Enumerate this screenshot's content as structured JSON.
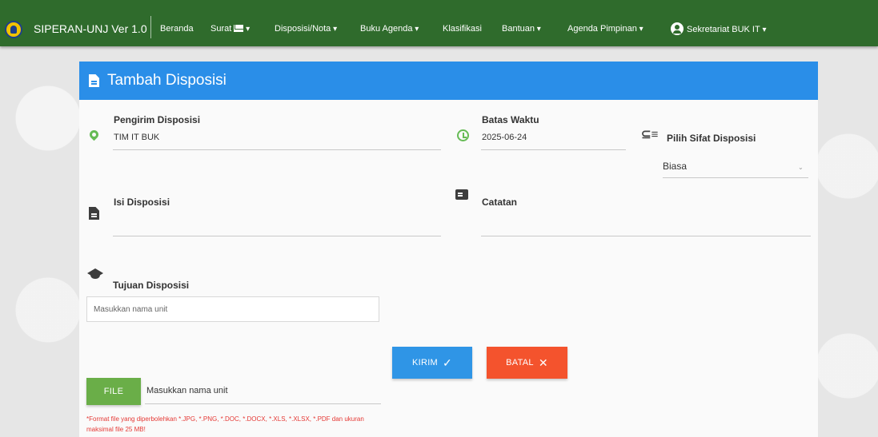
{
  "navbar": {
    "brand": "SIPERAN-UNJ Ver 1.0",
    "items": [
      {
        "label": "Beranda",
        "dropdown": false
      },
      {
        "label": "Surat",
        "dropdown": true,
        "icon": "mail-icon"
      },
      {
        "label": "Disposisi/Nota",
        "dropdown": true
      },
      {
        "label": "Buku Agenda",
        "dropdown": true
      },
      {
        "label": "Klasifikasi",
        "dropdown": false
      },
      {
        "label": "Bantuan",
        "dropdown": true
      },
      {
        "label": "Agenda Pimpinan",
        "dropdown": true
      }
    ],
    "user": {
      "label": "Sekretariat BUK IT",
      "icon": "user-circle-icon"
    },
    "color": "#2f6b2c"
  },
  "card": {
    "title": "Tambah Disposisi",
    "header_color": "#2a8ee8"
  },
  "form": {
    "pengirim": {
      "label": "Pengirim Disposisi",
      "value": "TIM IT BUK",
      "icon": "map-marker-icon"
    },
    "batas_waktu": {
      "label": "Batas Waktu",
      "value": "2025-06-24",
      "icon": "alarm-clock-icon"
    },
    "sifat": {
      "label": "Pilih Sifat Disposisi",
      "selected": "Biasa",
      "icon": "list-icon"
    },
    "isi": {
      "label": "Isi Disposisi",
      "value": "",
      "icon": "file-icon"
    },
    "catatan": {
      "label": "Catatan",
      "value": "",
      "icon": "note-icon"
    },
    "tujuan": {
      "label": "Tujuan Disposisi",
      "placeholder": "Masukkan nama unit",
      "icon": "graduation-cap-icon"
    },
    "file": {
      "button": "FILE",
      "text": "Masukkan nama unit"
    },
    "file_note": "*Format file yang diperbolehkan *.JPG, *.PNG, *.DOC, *.DOCX, *.XLS, *.XLSX, *.PDF dan ukuran maksimal file 25 MB!"
  },
  "actions": {
    "kirim": {
      "label": "KIRIM",
      "glyph": "✓",
      "color": "#2f95e6"
    },
    "batal": {
      "label": "BATAL",
      "glyph": "✕",
      "color": "#f4532d"
    }
  }
}
